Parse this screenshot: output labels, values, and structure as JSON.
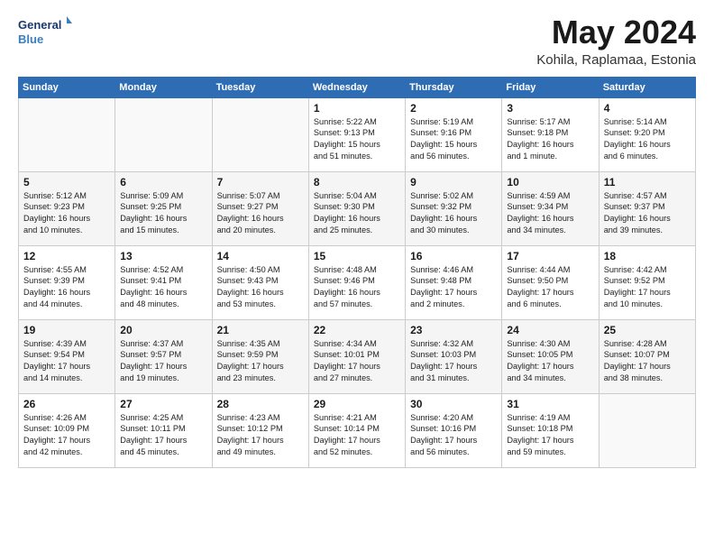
{
  "logo": {
    "line1": "General",
    "line2": "Blue"
  },
  "title": "May 2024",
  "location": "Kohila, Raplamaa, Estonia",
  "weekdays": [
    "Sunday",
    "Monday",
    "Tuesday",
    "Wednesday",
    "Thursday",
    "Friday",
    "Saturday"
  ],
  "weeks": [
    [
      {
        "num": "",
        "info": ""
      },
      {
        "num": "",
        "info": ""
      },
      {
        "num": "",
        "info": ""
      },
      {
        "num": "1",
        "info": "Sunrise: 5:22 AM\nSunset: 9:13 PM\nDaylight: 15 hours\nand 51 minutes."
      },
      {
        "num": "2",
        "info": "Sunrise: 5:19 AM\nSunset: 9:16 PM\nDaylight: 15 hours\nand 56 minutes."
      },
      {
        "num": "3",
        "info": "Sunrise: 5:17 AM\nSunset: 9:18 PM\nDaylight: 16 hours\nand 1 minute."
      },
      {
        "num": "4",
        "info": "Sunrise: 5:14 AM\nSunset: 9:20 PM\nDaylight: 16 hours\nand 6 minutes."
      }
    ],
    [
      {
        "num": "5",
        "info": "Sunrise: 5:12 AM\nSunset: 9:23 PM\nDaylight: 16 hours\nand 10 minutes."
      },
      {
        "num": "6",
        "info": "Sunrise: 5:09 AM\nSunset: 9:25 PM\nDaylight: 16 hours\nand 15 minutes."
      },
      {
        "num": "7",
        "info": "Sunrise: 5:07 AM\nSunset: 9:27 PM\nDaylight: 16 hours\nand 20 minutes."
      },
      {
        "num": "8",
        "info": "Sunrise: 5:04 AM\nSunset: 9:30 PM\nDaylight: 16 hours\nand 25 minutes."
      },
      {
        "num": "9",
        "info": "Sunrise: 5:02 AM\nSunset: 9:32 PM\nDaylight: 16 hours\nand 30 minutes."
      },
      {
        "num": "10",
        "info": "Sunrise: 4:59 AM\nSunset: 9:34 PM\nDaylight: 16 hours\nand 34 minutes."
      },
      {
        "num": "11",
        "info": "Sunrise: 4:57 AM\nSunset: 9:37 PM\nDaylight: 16 hours\nand 39 minutes."
      }
    ],
    [
      {
        "num": "12",
        "info": "Sunrise: 4:55 AM\nSunset: 9:39 PM\nDaylight: 16 hours\nand 44 minutes."
      },
      {
        "num": "13",
        "info": "Sunrise: 4:52 AM\nSunset: 9:41 PM\nDaylight: 16 hours\nand 48 minutes."
      },
      {
        "num": "14",
        "info": "Sunrise: 4:50 AM\nSunset: 9:43 PM\nDaylight: 16 hours\nand 53 minutes."
      },
      {
        "num": "15",
        "info": "Sunrise: 4:48 AM\nSunset: 9:46 PM\nDaylight: 16 hours\nand 57 minutes."
      },
      {
        "num": "16",
        "info": "Sunrise: 4:46 AM\nSunset: 9:48 PM\nDaylight: 17 hours\nand 2 minutes."
      },
      {
        "num": "17",
        "info": "Sunrise: 4:44 AM\nSunset: 9:50 PM\nDaylight: 17 hours\nand 6 minutes."
      },
      {
        "num": "18",
        "info": "Sunrise: 4:42 AM\nSunset: 9:52 PM\nDaylight: 17 hours\nand 10 minutes."
      }
    ],
    [
      {
        "num": "19",
        "info": "Sunrise: 4:39 AM\nSunset: 9:54 PM\nDaylight: 17 hours\nand 14 minutes."
      },
      {
        "num": "20",
        "info": "Sunrise: 4:37 AM\nSunset: 9:57 PM\nDaylight: 17 hours\nand 19 minutes."
      },
      {
        "num": "21",
        "info": "Sunrise: 4:35 AM\nSunset: 9:59 PM\nDaylight: 17 hours\nand 23 minutes."
      },
      {
        "num": "22",
        "info": "Sunrise: 4:34 AM\nSunset: 10:01 PM\nDaylight: 17 hours\nand 27 minutes."
      },
      {
        "num": "23",
        "info": "Sunrise: 4:32 AM\nSunset: 10:03 PM\nDaylight: 17 hours\nand 31 minutes."
      },
      {
        "num": "24",
        "info": "Sunrise: 4:30 AM\nSunset: 10:05 PM\nDaylight: 17 hours\nand 34 minutes."
      },
      {
        "num": "25",
        "info": "Sunrise: 4:28 AM\nSunset: 10:07 PM\nDaylight: 17 hours\nand 38 minutes."
      }
    ],
    [
      {
        "num": "26",
        "info": "Sunrise: 4:26 AM\nSunset: 10:09 PM\nDaylight: 17 hours\nand 42 minutes."
      },
      {
        "num": "27",
        "info": "Sunrise: 4:25 AM\nSunset: 10:11 PM\nDaylight: 17 hours\nand 45 minutes."
      },
      {
        "num": "28",
        "info": "Sunrise: 4:23 AM\nSunset: 10:12 PM\nDaylight: 17 hours\nand 49 minutes."
      },
      {
        "num": "29",
        "info": "Sunrise: 4:21 AM\nSunset: 10:14 PM\nDaylight: 17 hours\nand 52 minutes."
      },
      {
        "num": "30",
        "info": "Sunrise: 4:20 AM\nSunset: 10:16 PM\nDaylight: 17 hours\nand 56 minutes."
      },
      {
        "num": "31",
        "info": "Sunrise: 4:19 AM\nSunset: 10:18 PM\nDaylight: 17 hours\nand 59 minutes."
      },
      {
        "num": "",
        "info": ""
      }
    ]
  ]
}
